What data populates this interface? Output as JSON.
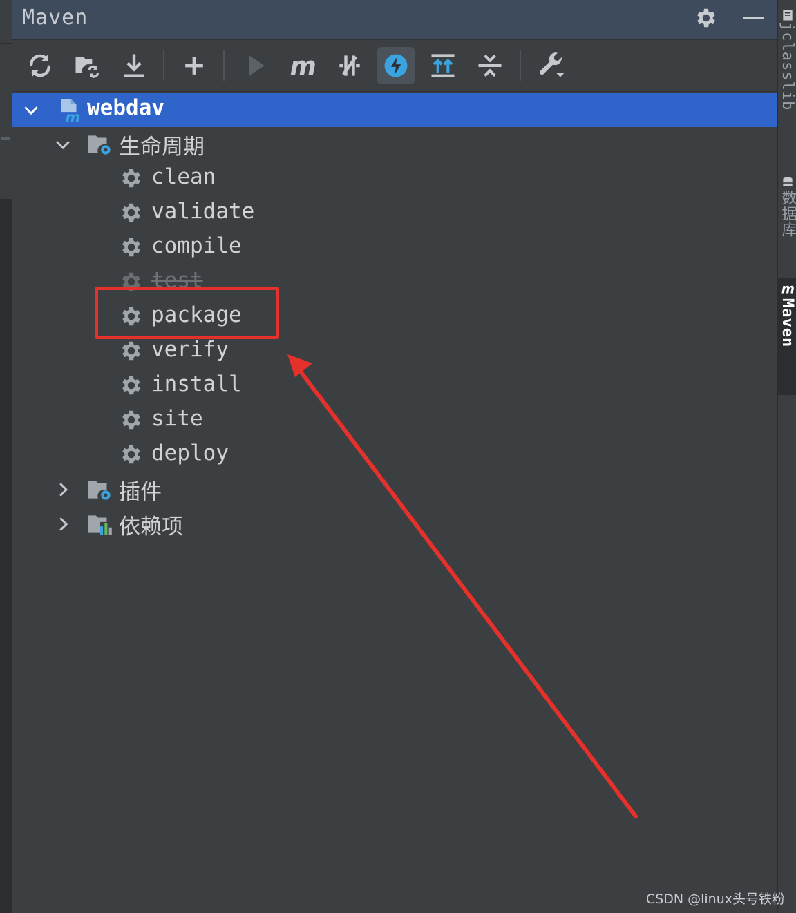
{
  "window": {
    "title": "Maven"
  },
  "toolbar": {
    "buttons": [
      {
        "name": "reload-icon"
      },
      {
        "name": "generate-sources-icon"
      },
      {
        "name": "download-icon"
      },
      {
        "name": "add-icon"
      },
      {
        "name": "run-icon"
      },
      {
        "name": "execute-goal-icon"
      },
      {
        "name": "toggle-offline-icon"
      },
      {
        "name": "skip-tests-icon"
      },
      {
        "name": "show-dependencies-icon"
      },
      {
        "name": "collapse-all-icon"
      },
      {
        "name": "build-tool-settings-icon"
      }
    ]
  },
  "tree": {
    "project": {
      "label": "webdav"
    },
    "lifecycle": {
      "label": "生命周期",
      "goals": [
        "clean",
        "validate",
        "compile",
        "test",
        "package",
        "verify",
        "install",
        "site",
        "deploy"
      ]
    },
    "plugins": {
      "label": "插件"
    },
    "dependencies": {
      "label": "依赖项"
    }
  },
  "right_sidebar": {
    "tabs": [
      {
        "label": "jclasslib"
      },
      {
        "label": "数据库"
      },
      {
        "label": "Maven"
      }
    ]
  },
  "annotation": {
    "highlight": "package"
  },
  "watermark": "CSDN @linux头号铁粉",
  "colors": {
    "selection": "#2f65ca",
    "panel_bg": "#3c3f41",
    "accent_blue": "#3aa3e0",
    "annotation_red": "#e5312b"
  }
}
